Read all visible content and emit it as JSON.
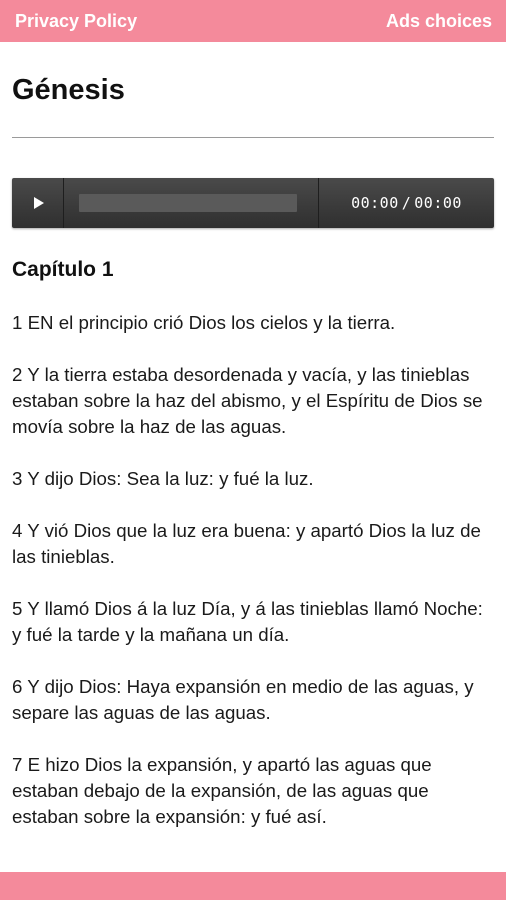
{
  "topbar": {
    "privacy_label": "Privacy Policy",
    "ads_label": "Ads choices",
    "color": "#f48a9b"
  },
  "book": {
    "title": "Génesis"
  },
  "audio": {
    "current_time": "00:00",
    "separator": "/",
    "duration": "00:00",
    "play_icon": "play-icon"
  },
  "chapter": {
    "heading": "Capítulo 1",
    "verses": [
      "1 EN el principio crió Dios los cielos y la tierra.",
      "2 Y la tierra estaba desordenada y vacía, y las tinieblas estaban sobre la haz del abismo, y el Espíritu de Dios se movía sobre la haz de las aguas.",
      "3 Y dijo Dios: Sea la luz: y fué la luz.",
      "4 Y vió Dios que la luz era buena: y apartó Dios la luz de las tinieblas.",
      "5 Y llamó Dios á la luz Día, y á las tinieblas llamó Noche: y fué la tarde y la mañana un día.",
      "6 Y dijo Dios: Haya expansión en medio de las aguas, y separe las aguas de las aguas.",
      "7 E hizo Dios la expansión, y apartó las aguas que estaban debajo de la expansión, de las aguas que estaban sobre la expansión: y fué así."
    ]
  }
}
